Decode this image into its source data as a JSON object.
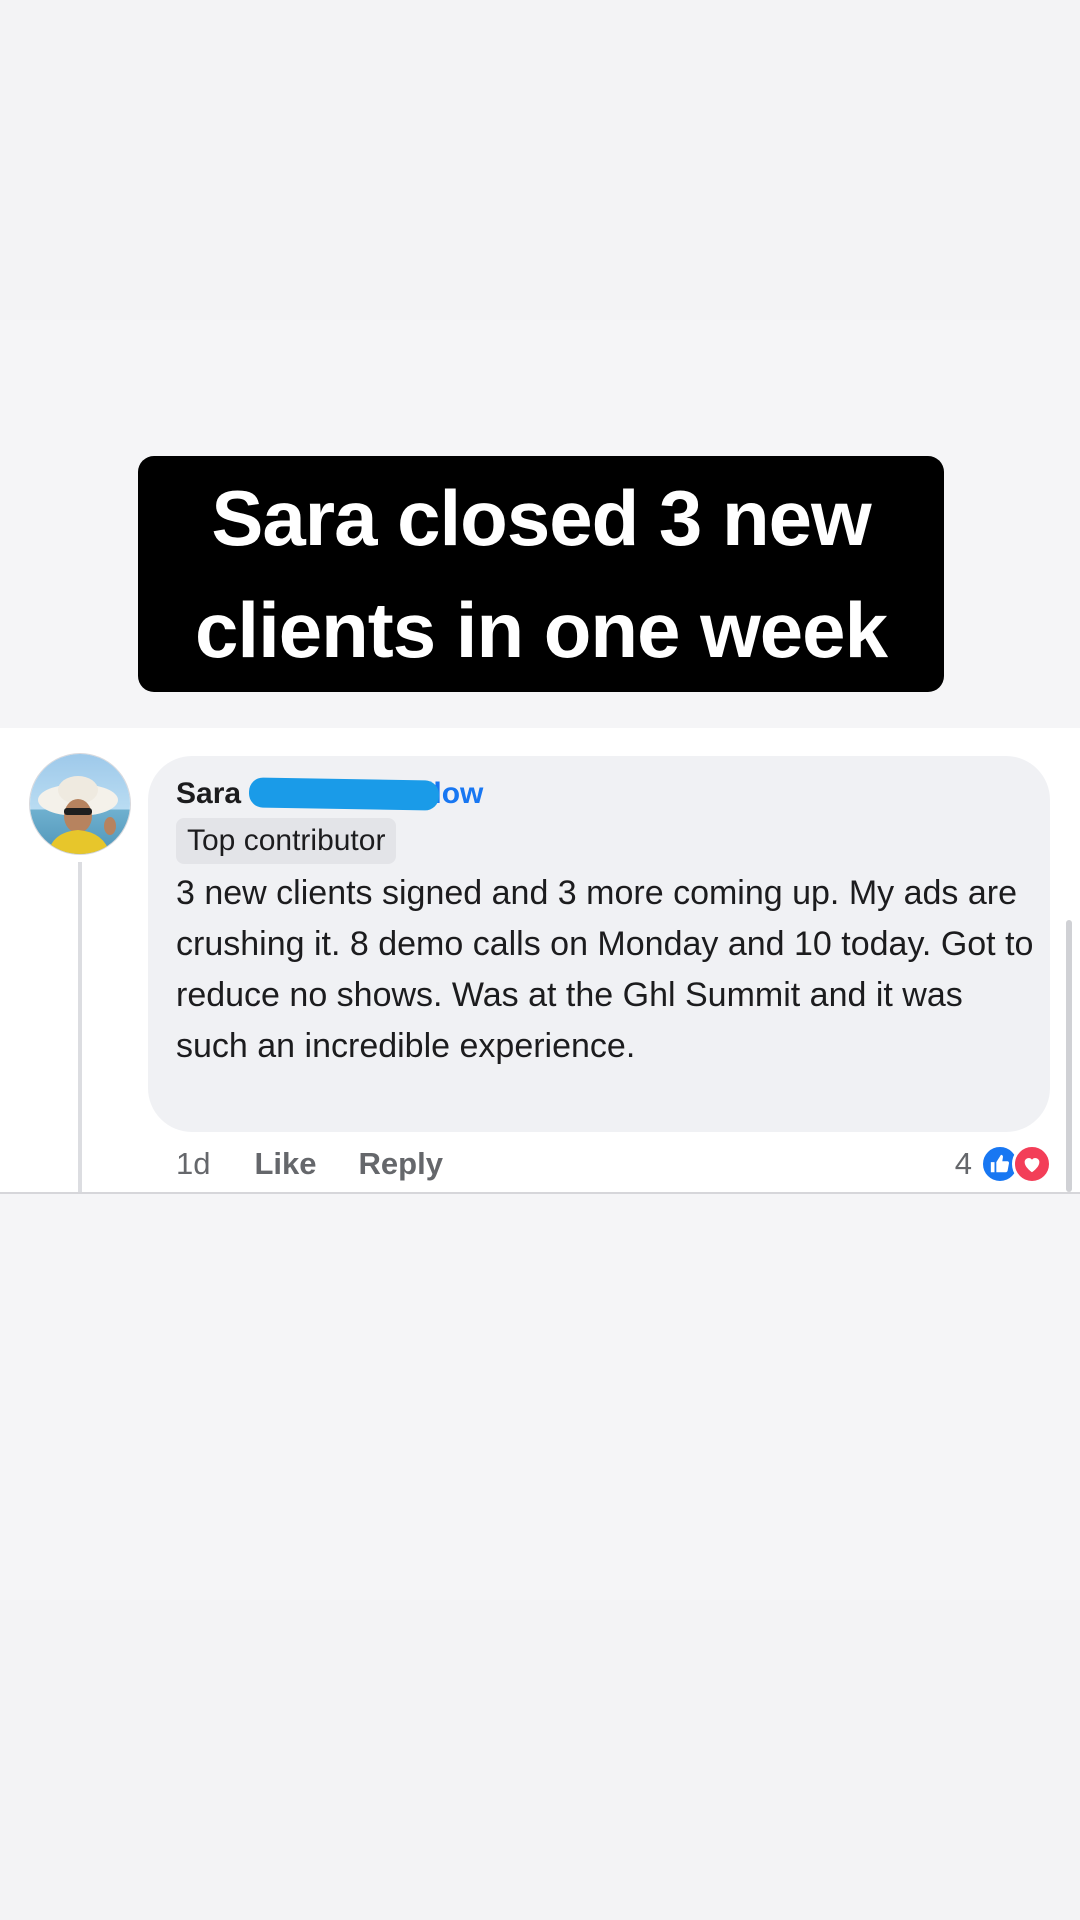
{
  "overlay": {
    "headline": "Sara closed 3 new\nclients in one week"
  },
  "comment": {
    "author_first_name": "Sara",
    "follow_label": "llow",
    "badge": "Top contributor",
    "body": "3 new clients signed and 3 more coming up. My ads are crushing it. 8 demo calls on Monday and 10 today. Got to reduce no shows. Was at the Ghl Summit and it was such an incredible experience.",
    "timestamp": "1d",
    "like_label": "Like",
    "reply_label": "Reply",
    "reaction_count": "4",
    "reactions": [
      "like-icon",
      "love-icon"
    ]
  },
  "colors": {
    "link_blue": "#1877f2",
    "like_blue": "#1877f2",
    "love_red": "#f33e58",
    "redaction_blue": "#1a9be8",
    "bubble_gray": "#f0f1f4"
  }
}
